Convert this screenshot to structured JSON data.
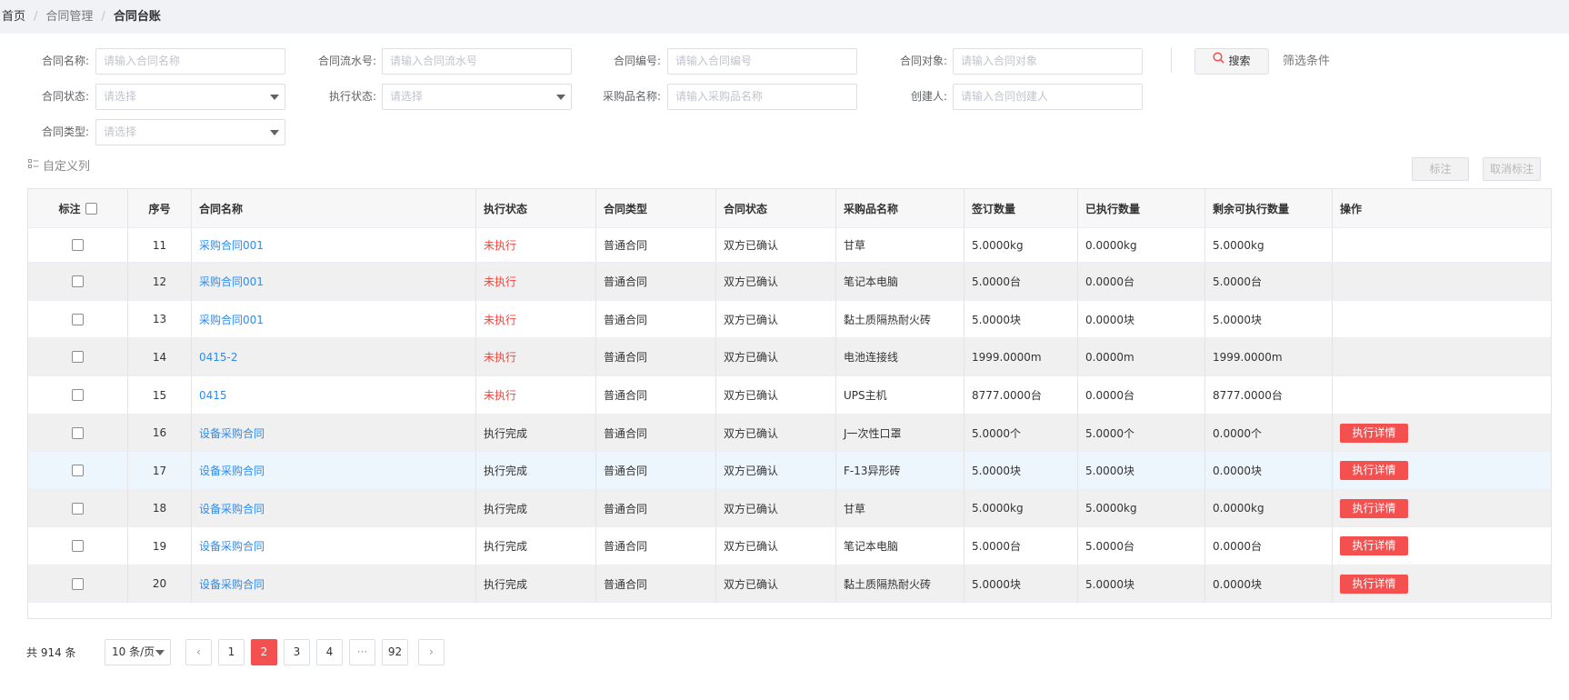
{
  "breadcrumb": {
    "home": "首页",
    "sep1": "/",
    "parent": "合同管理",
    "sep2": "/",
    "current": "合同台账"
  },
  "filters": {
    "contract_name": {
      "label": "合同名称:",
      "placeholder": "请输入合同名称"
    },
    "serial_no": {
      "label": "合同流水号:",
      "placeholder": "请输入合同流水号"
    },
    "contract_no": {
      "label": "合同编号:",
      "placeholder": "请输入合同编号"
    },
    "contract_party": {
      "label": "合同对象:",
      "placeholder": "请输入合同对象"
    },
    "contract_status": {
      "label": "合同状态:",
      "placeholder": "请选择"
    },
    "exec_status": {
      "label": "执行状态:",
      "placeholder": "请选择"
    },
    "goods_name": {
      "label": "采购品名称:",
      "placeholder": "请输入采购品名称"
    },
    "creator": {
      "label": "创建人:",
      "placeholder": "请输入合同创建人"
    },
    "contract_type": {
      "label": "合同类型:",
      "placeholder": "请选择"
    }
  },
  "actions": {
    "search": "搜索",
    "filter_conditions": "筛选条件",
    "custom_columns": "自定义列",
    "mark": "标注",
    "unmark": "取消标注"
  },
  "table": {
    "headers": [
      "标注",
      "序号",
      "合同名称",
      "执行状态",
      "合同类型",
      "合同状态",
      "采购品名称",
      "签订数量",
      "已执行数量",
      "剩余可执行数量",
      "操作"
    ],
    "rows": [
      {
        "no": "11",
        "name": "采购合同001",
        "exec": "未执行",
        "type": "普通合同",
        "status": "双方已确认",
        "goods": "甘草",
        "signed": "5.0000kg",
        "executed": "0.0000kg",
        "remaining": "5.0000kg",
        "op": ""
      },
      {
        "no": "12",
        "name": "采购合同001",
        "exec": "未执行",
        "type": "普通合同",
        "status": "双方已确认",
        "goods": "笔记本电脑",
        "signed": "5.0000台",
        "executed": "0.0000台",
        "remaining": "5.0000台",
        "op": ""
      },
      {
        "no": "13",
        "name": "采购合同001",
        "exec": "未执行",
        "type": "普通合同",
        "status": "双方已确认",
        "goods": "黏土质隔热耐火砖",
        "signed": "5.0000块",
        "executed": "0.0000块",
        "remaining": "5.0000块",
        "op": ""
      },
      {
        "no": "14",
        "name": "0415-2",
        "exec": "未执行",
        "type": "普通合同",
        "status": "双方已确认",
        "goods": "电池连接线",
        "signed": "1999.0000m",
        "executed": "0.0000m",
        "remaining": "1999.0000m",
        "op": ""
      },
      {
        "no": "15",
        "name": "0415",
        "exec": "未执行",
        "type": "普通合同",
        "status": "双方已确认",
        "goods": "UPS主机",
        "signed": "8777.0000台",
        "executed": "0.0000台",
        "remaining": "8777.0000台",
        "op": ""
      },
      {
        "no": "16",
        "name": "设备采购合同",
        "exec": "执行完成",
        "type": "普通合同",
        "status": "双方已确认",
        "goods": "J一次性口罩",
        "signed": "5.0000个",
        "executed": "5.0000个",
        "remaining": "0.0000个",
        "op": "执行详情"
      },
      {
        "no": "17",
        "name": "设备采购合同",
        "exec": "执行完成",
        "type": "普通合同",
        "status": "双方已确认",
        "goods": "F-13异形砖",
        "signed": "5.0000块",
        "executed": "5.0000块",
        "remaining": "0.0000块",
        "op": "执行详情"
      },
      {
        "no": "18",
        "name": "设备采购合同",
        "exec": "执行完成",
        "type": "普通合同",
        "status": "双方已确认",
        "goods": "甘草",
        "signed": "5.0000kg",
        "executed": "5.0000kg",
        "remaining": "0.0000kg",
        "op": "执行详情"
      },
      {
        "no": "19",
        "name": "设备采购合同",
        "exec": "执行完成",
        "type": "普通合同",
        "status": "双方已确认",
        "goods": "笔记本电脑",
        "signed": "5.0000台",
        "executed": "5.0000台",
        "remaining": "0.0000台",
        "op": "执行详情"
      },
      {
        "no": "20",
        "name": "设备采购合同",
        "exec": "执行完成",
        "type": "普通合同",
        "status": "双方已确认",
        "goods": "黏土质隔热耐火砖",
        "signed": "5.0000块",
        "executed": "5.0000块",
        "remaining": "0.0000块",
        "op": "执行详情"
      }
    ]
  },
  "pagination": {
    "total": "共 914 条",
    "page_size": "10 条/页",
    "prev": "‹",
    "next": "›",
    "pages": [
      "1",
      "2",
      "3",
      "4",
      "···",
      "92"
    ],
    "current": "2"
  },
  "colors": {
    "accent": "#f4504f",
    "link": "#2d8cf0",
    "not_executed": "#f4443c"
  }
}
